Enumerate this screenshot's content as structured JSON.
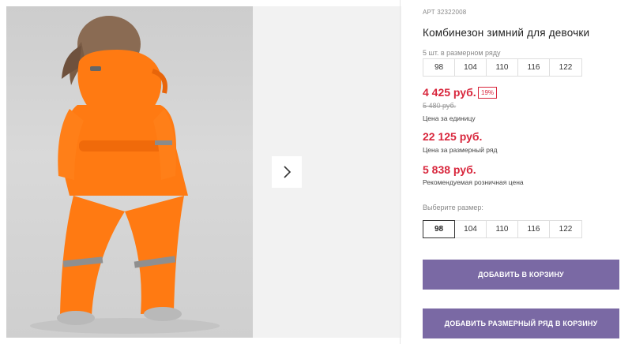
{
  "product": {
    "sku": "АРТ 32322008",
    "title": "Комбинезон зимний для девочки",
    "set_note": "5 шт. в размерном ряду",
    "set_sizes": [
      "98",
      "104",
      "110",
      "116",
      "122"
    ],
    "price_unit": "4 425 руб.",
    "discount": "19%",
    "old_price": "5 480 руб.",
    "price_unit_label": "Цена за единицу",
    "price_set": "22 125 руб.",
    "price_set_label": "Цена за размерный ряд",
    "price_retail": "5 838 руб.",
    "price_retail_label": "Рекомендуемая розничная цена",
    "choose_size_label": "Выберите размер:",
    "size_options": [
      "98",
      "104",
      "110",
      "116",
      "122"
    ],
    "selected_size": "98",
    "add_to_cart_label": "ДОБАВИТЬ В КОРЗИНУ",
    "add_set_to_cart_label": "ДОБАВИТЬ РАЗМЕРНЫЙ РЯД В КОРЗИНУ"
  },
  "gallery": {
    "next_icon": "chevron-right-icon"
  },
  "colors": {
    "price_red": "#d8263c",
    "button_purple": "#7a69a4",
    "jumpsuit_orange": "#ff7a12"
  }
}
